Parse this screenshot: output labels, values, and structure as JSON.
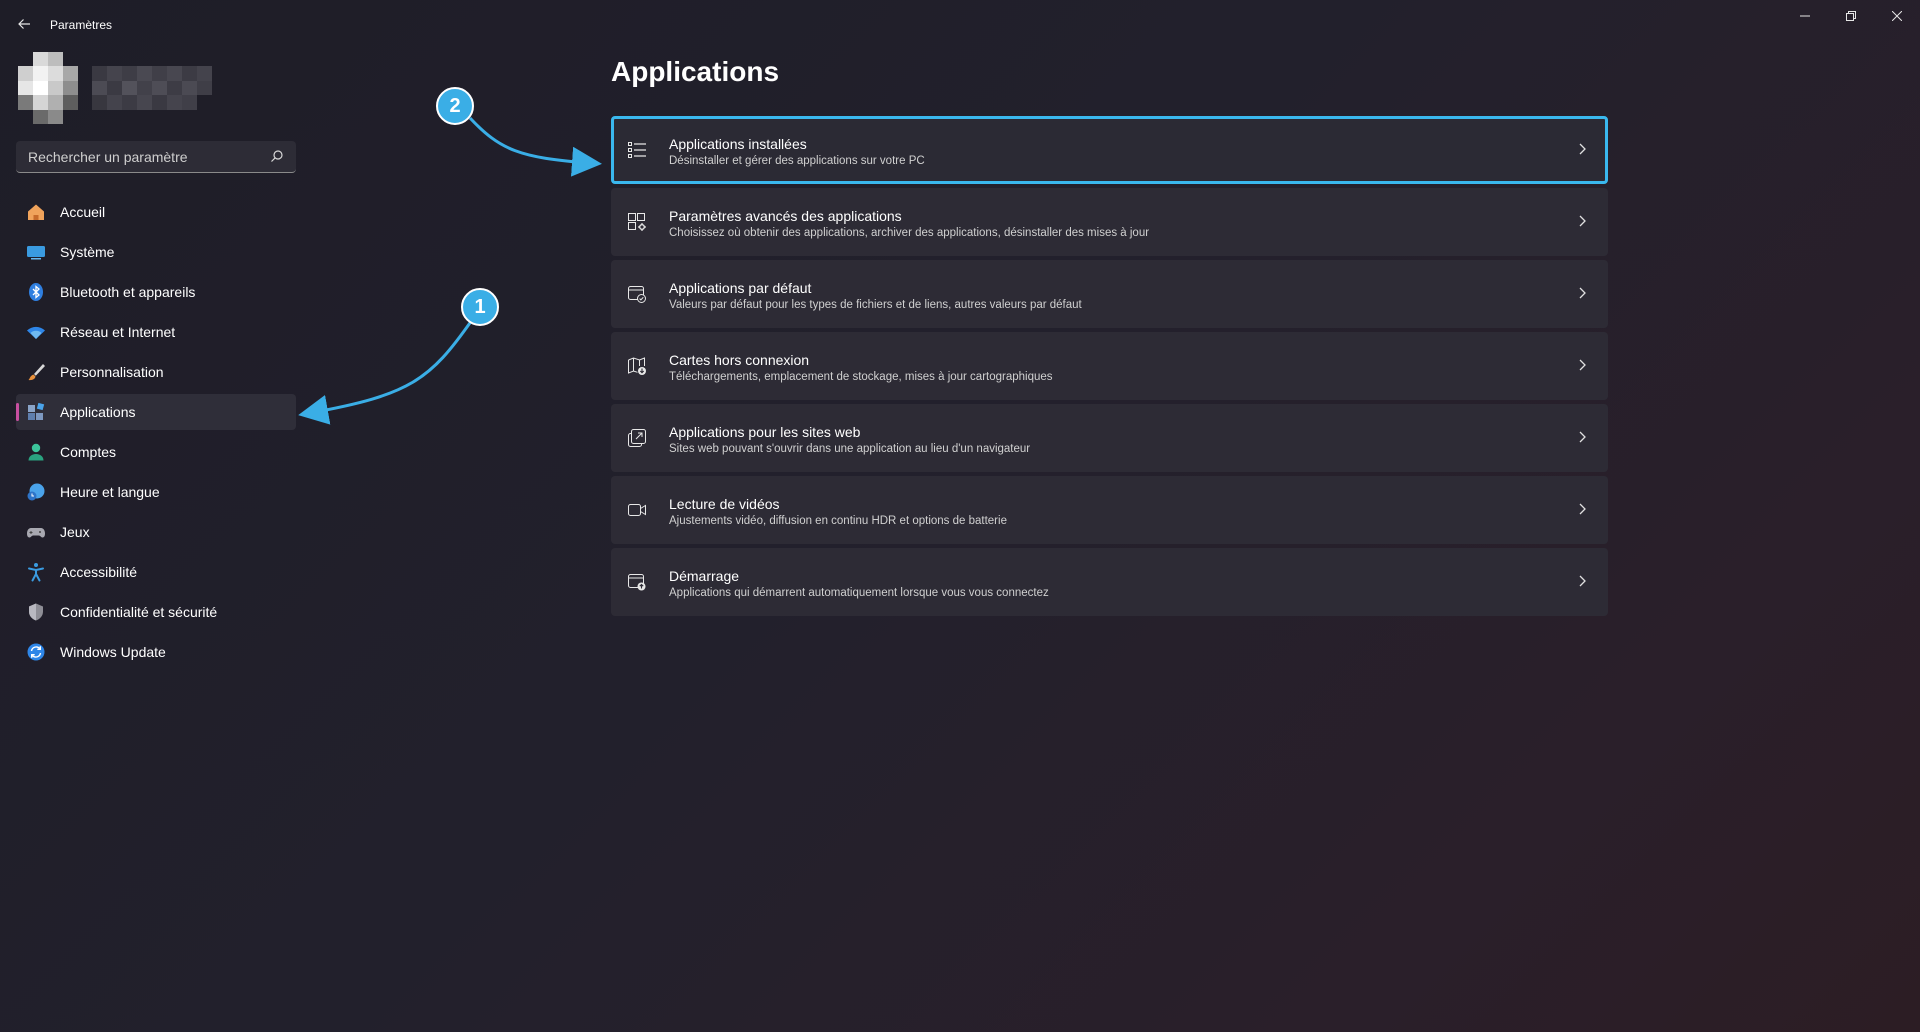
{
  "window": {
    "title": "Paramètres",
    "controls": {
      "minimize": "—",
      "restore": "❐",
      "close": "✕"
    }
  },
  "search": {
    "placeholder": "Rechercher un paramètre"
  },
  "sidebar": {
    "items": [
      {
        "label": "Accueil",
        "icon": "home-icon"
      },
      {
        "label": "Système",
        "icon": "monitor-icon"
      },
      {
        "label": "Bluetooth et appareils",
        "icon": "bluetooth-icon"
      },
      {
        "label": "Réseau et Internet",
        "icon": "wifi-icon"
      },
      {
        "label": "Personnalisation",
        "icon": "brush-icon"
      },
      {
        "label": "Applications",
        "icon": "apps-icon",
        "selected": true
      },
      {
        "label": "Comptes",
        "icon": "person-icon"
      },
      {
        "label": "Heure et langue",
        "icon": "clock-globe-icon"
      },
      {
        "label": "Jeux",
        "icon": "gamepad-icon"
      },
      {
        "label": "Accessibilité",
        "icon": "accessibility-icon"
      },
      {
        "label": "Confidentialité et sécurité",
        "icon": "shield-icon"
      },
      {
        "label": "Windows Update",
        "icon": "update-icon"
      }
    ]
  },
  "main": {
    "title": "Applications",
    "cards": [
      {
        "title": "Applications installées",
        "subtitle": "Désinstaller et gérer des applications sur votre PC",
        "icon": "list-icon",
        "focused": true
      },
      {
        "title": "Paramètres avancés des applications",
        "subtitle": "Choisissez où obtenir des applications, archiver des applications, désinstaller des mises à jour",
        "icon": "apps-settings-icon"
      },
      {
        "title": "Applications par défaut",
        "subtitle": "Valeurs par défaut pour les types de fichiers et de liens, autres valeurs par défaut",
        "icon": "default-apps-icon"
      },
      {
        "title": "Cartes hors connexion",
        "subtitle": "Téléchargements, emplacement de stockage, mises à jour cartographiques",
        "icon": "map-download-icon"
      },
      {
        "title": "Applications pour les sites web",
        "subtitle": "Sites web pouvant s'ouvrir dans une application au lieu d'un navigateur",
        "icon": "open-external-icon"
      },
      {
        "title": "Lecture de vidéos",
        "subtitle": "Ajustements vidéo, diffusion en continu HDR et options de batterie",
        "icon": "video-camera-icon"
      },
      {
        "title": "Démarrage",
        "subtitle": "Applications qui démarrent automatiquement lorsque vous vous connectez",
        "icon": "startup-icon"
      }
    ]
  },
  "annotations": {
    "badge_1": "1",
    "badge_2": "2",
    "color": "#3aaee6"
  },
  "colors": {
    "accent_selected": "#c84fa0",
    "focus_border": "#3ab8ee"
  }
}
